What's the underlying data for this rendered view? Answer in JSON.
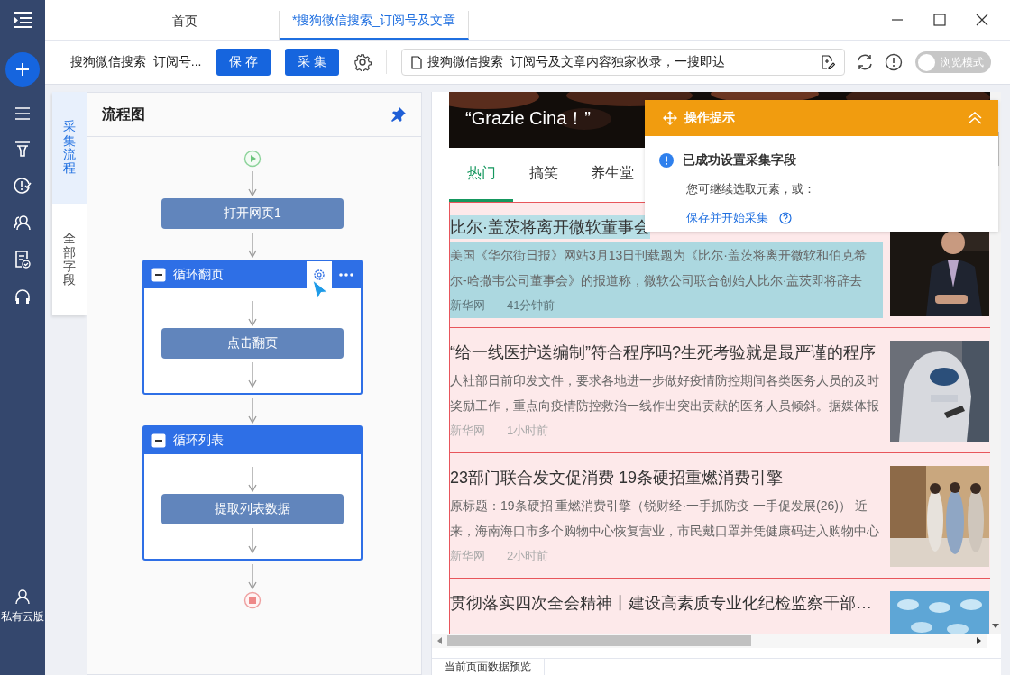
{
  "nav": {
    "footer_label": "私有云版"
  },
  "tabs": [
    {
      "label": "首页",
      "selected": false
    },
    {
      "label": "*搜狗微信搜索_订阅号及文章",
      "selected": true
    }
  ],
  "toolbar": {
    "task_name": "搜狗微信搜索_订阅号...",
    "buttons": [
      "保 存",
      "采 集"
    ],
    "address": "搜狗微信搜索_订阅号及文章内容独家收录，一搜即达",
    "browse_mode": {
      "label": "浏览模式",
      "on": false
    }
  },
  "side_tabs": [
    {
      "label": "采集流程",
      "selected": true
    },
    {
      "label": "全部字段",
      "selected": false
    }
  ],
  "flow": {
    "title": "流程图",
    "nodes": [
      {
        "kind": "start"
      },
      {
        "kind": "action",
        "label": "打开网页1"
      },
      {
        "kind": "loop",
        "label": "循环翻页",
        "expanded": true,
        "tools_visible": true,
        "children": [
          {
            "kind": "action",
            "label": "点击翻页"
          }
        ]
      },
      {
        "kind": "loop",
        "label": "循环列表",
        "expanded": true,
        "tools_visible": false,
        "children": [
          {
            "kind": "action",
            "label": "提取列表数据"
          }
        ]
      },
      {
        "kind": "end"
      }
    ]
  },
  "browser": {
    "banner": {
      "caption": "“Grazie Cina！”"
    },
    "news_tabs": [
      {
        "label": "热门",
        "selected": true
      },
      {
        "label": "搞笑",
        "selected": false
      },
      {
        "label": "养生堂",
        "selected": false
      }
    ],
    "articles": [
      {
        "title": "比尔·盖茨将离开微软董事会",
        "summary": "美国《华尔街日报》网站3月13日刊载题为《比尔·盖茨将离开微软和伯克希尔-哈撒韦公司董事会》的报道称，微软公司联合创始人比尔·盖茨即将辞去",
        "source": "新华网",
        "time": "41分钟前",
        "selected": true
      },
      {
        "title": "“给一线医护送编制”符合程序吗?生死考验就是最严谨的程序",
        "summary": "人社部日前印发文件，要求各地进一步做好疫情防控期间各类医务人员的及时奖励工作，重点向疫情防控救治一线作出突出贡献的医务人员倾斜。据媒体报",
        "source": "新华网",
        "time": "1小时前",
        "selected": false
      },
      {
        "title": "23部门联合发文促消费 19条硬招重燃消费引擎",
        "summary": "原标题：19条硬招 重燃消费引擎（锐财经·一手抓防疫 一手促发展(26)） 近来，海南海口市多个购物中心恢复营业，市民戴口罩并凭健康码进入购物中心",
        "source": "新华网",
        "time": "2小时前",
        "selected": false
      },
      {
        "title": "贯彻落实四次全会精神丨建设高素质专业化纪检监察干部…",
        "selected": false
      }
    ]
  },
  "tip": {
    "title": "操作提示",
    "message": "已成功设置采集字段",
    "hint": "您可继续选取元素，或：",
    "link": "保存并开始采集"
  },
  "bottom_tabs": [
    "当前页面数据预览"
  ]
}
